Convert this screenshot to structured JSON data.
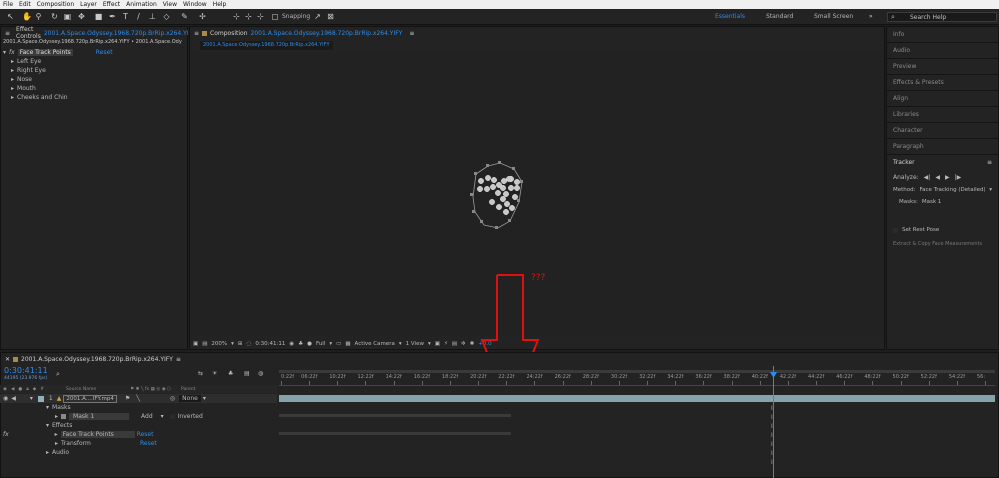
{
  "menu": [
    "File",
    "Edit",
    "Composition",
    "Layer",
    "Effect",
    "Animation",
    "View",
    "Window",
    "Help"
  ],
  "toolbar": {
    "snapping": "Snapping",
    "workspaces": [
      "Essentials",
      "Standard",
      "Small Screen"
    ],
    "active_workspace": "Essentials",
    "search_placeholder": "Search Help"
  },
  "effect_controls": {
    "tab_title": "Effect Controls",
    "tab_file": "2001.A.Space.Odyssey.1968.720p.BrRip.x264.YIFY",
    "breadcrumb": "2001.A.Space.Odyssey.1968.720p.BrRip.x264.YIFY • 2001.A.Space.Ody",
    "fx_label": "fx",
    "effect_name": "Face Track Points",
    "reset": "Reset",
    "items": [
      "Left Eye",
      "Right Eye",
      "Nose",
      "Mouth",
      "Cheeks and Chin"
    ]
  },
  "composition": {
    "tab_title": "Composition",
    "tab_file": "2001.A.Space.Odyssey.1968.720p.BrRip.x264.YIFY",
    "sub_tab": "2001.A.Space.Odyssey.1968.720p.BrRip.x264.YIFY",
    "annotation": "???",
    "footer": {
      "zoom": "200%",
      "timecode": "0:30:41:11",
      "resolution": "Full",
      "camera": "Active Camera",
      "view": "1 View",
      "exposure": "+0.0"
    }
  },
  "right_panels": [
    "Info",
    "Audio",
    "Preview",
    "Effects & Presets",
    "Align",
    "Libraries",
    "Character",
    "Paragraph"
  ],
  "tracker": {
    "title": "Tracker",
    "analyze_label": "Analyze:",
    "method_label": "Method:",
    "method_value": "Face Tracking (Detailed)",
    "masks_label": "Masks:",
    "masks_value": "Mask 1",
    "set_rest_pose": "Set Rest Pose",
    "extract": "Extract & Copy Face Measurements"
  },
  "timeline": {
    "tab": "2001.A.Space.Odyssey.1968.720p.BrRip.x264.YIFY",
    "timecode": "0:30:41:11",
    "frame_info": "44195 (23.976 fps)",
    "search_placeholder": "",
    "col_source": "Source Name",
    "col_parent": "Parent",
    "layer_num": "1",
    "layer_name": "2001.A....IFY.mp4",
    "parent_value": "None",
    "masks": "Masks",
    "mask1": "Mask 1",
    "mask_mode": "Add",
    "inverted": "Inverted",
    "effects": "Effects",
    "face_track_points": "Face Track Points",
    "reset1": "Reset",
    "transform": "Transform",
    "reset2": "Reset",
    "audio": "Audio",
    "fx": "fx",
    "ruler": [
      "06:22f",
      "10:22f",
      "12:22f",
      "14:22f",
      "16:22f",
      "18:22f",
      "20:22f",
      "22:22f",
      "24:22f",
      "26:22f",
      "28:22f",
      "30:22f",
      "32:22f",
      "34:22f",
      "36:22f",
      "38:22f",
      "40:22f",
      "42:22f",
      "44:22f",
      "46:22f",
      "48:22f",
      "50:22f",
      "52:22f",
      "54:22f",
      "56:"
    ],
    "ruler_start": "0:22f",
    "playhead_fraction": 0.69
  },
  "colors": {
    "accent_blue": "#2d8ceb",
    "annotation_red": "#e01010",
    "layer_bar": "#8fb3b8"
  }
}
